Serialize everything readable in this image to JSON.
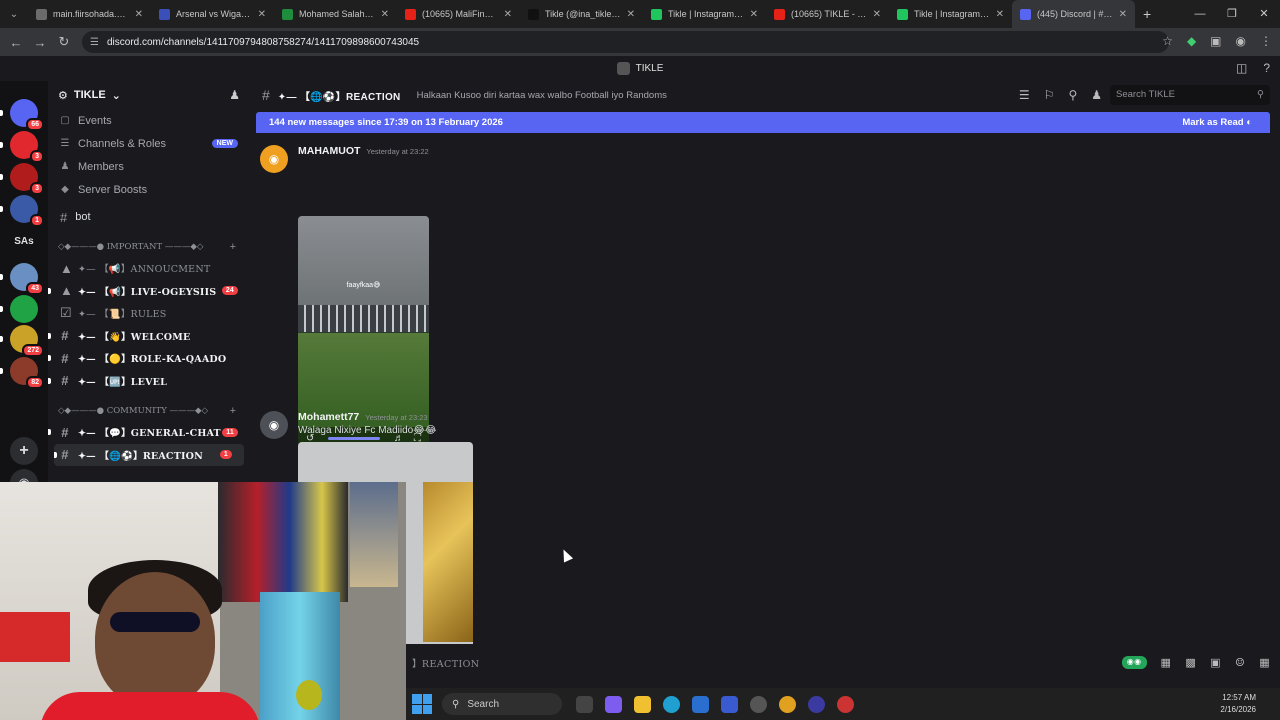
{
  "browser": {
    "tabs": [
      {
        "title": "main.fiirsohada.club",
        "color": "#6b6b6b"
      },
      {
        "title": "Arsenal vs Wigan - En",
        "color": "#3b4fb8"
      },
      {
        "title": "Mohamed Salah - sta",
        "color": "#1e8e3e"
      },
      {
        "title": "(10665) MaliFino - Yo",
        "color": "#e62117"
      },
      {
        "title": "Tikle (@ina_tikle) | Ti",
        "color": "#111111"
      },
      {
        "title": "Tikle | Instagram, Tik",
        "color": "#21c55d"
      },
      {
        "title": "(10665) TIKLE - YouTu",
        "color": "#e62117"
      },
      {
        "title": "Tikle | Instagram, Tik",
        "color": "#21c55d"
      },
      {
        "title": "(445) Discord | #✦—",
        "color": "#5865f2"
      }
    ],
    "url": "discord.com/channels/1411709794808758274/1411709898600743045"
  },
  "discord": {
    "window_title": "TIKLE",
    "server": {
      "name": "TIKLE",
      "nav": [
        {
          "label": "Events",
          "icon": "calendar-icon"
        },
        {
          "label": "Channels & Roles",
          "icon": "list-icon",
          "badge": "NEW"
        },
        {
          "label": "Members",
          "icon": "members-icon"
        },
        {
          "label": "Server Boosts",
          "icon": "boost-icon"
        }
      ],
      "bot_channel": "bot",
      "categories": [
        {
          "label": "◇◆———● IMPORTANT ———◆◇",
          "channels": [
            {
              "label": "✦— 【📢】ANNOUCMENT",
              "icon": "megaphone-icon",
              "unread": false
            },
            {
              "label": "✦— 【📢】LIVE-OGEYSIIS",
              "icon": "megaphone-icon",
              "unread": true,
              "badge": "24"
            },
            {
              "label": "✦— 【📜】RULES",
              "icon": "rules-icon",
              "unread": false
            },
            {
              "label": "✦— 【👋】WELCOME",
              "icon": "hash-icon",
              "unread": true
            },
            {
              "label": "✦— 【🟡】ROLE-KA-QAADO",
              "icon": "hash-icon",
              "unread": true
            },
            {
              "label": "✦— 【🆙】LEVEL",
              "icon": "hash-icon",
              "unread": true
            }
          ]
        },
        {
          "label": "◇◆———● COMMUNITY ———◆◇",
          "channels": [
            {
              "label": "✦— 【💬】GENERAL-CHAT",
              "icon": "hash-icon",
              "unread": true,
              "badge": "11"
            },
            {
              "label": "✦— 【🌐⚽】REACTION",
              "icon": "hash-icon",
              "unread": true,
              "badge": "1",
              "active": true
            }
          ]
        }
      ]
    },
    "guilds": [
      {
        "name": "dm-icon",
        "badge": "66",
        "color": "#5865f2"
      },
      {
        "name": "server-red-icon",
        "badge": "3",
        "color": "#e0282e"
      },
      {
        "name": "server-star-icon",
        "badge": "3",
        "color": "#b01c1c"
      },
      {
        "name": "server-ball-icon",
        "badge": "1",
        "color": "#3a5aa8"
      },
      {
        "name": "SAs",
        "badge": "",
        "color": ""
      },
      {
        "name": "server-photo-icon",
        "badge": "43",
        "color": "#6a8fc2"
      },
      {
        "name": "server-green-icon",
        "badge": "",
        "color": "#1fa345"
      },
      {
        "name": "server-gold-icon",
        "badge": "272",
        "color": "#c9a227"
      },
      {
        "name": "server-thumb-icon",
        "badge": "82",
        "color": "#8c3a2a"
      }
    ],
    "channel": {
      "name": "✦— 【🌐⚽】REACTION",
      "topic": "Halkaan Kusoo diri kartaa wax walbo Football iyo Randoms",
      "search_placeholder": "Search TIKLE"
    },
    "new_messages_bar": {
      "text": "144 new messages since 17:39 on 13 February 2026",
      "action": "Mark as Read"
    },
    "messages": [
      {
        "author": "MAHAMUOT",
        "timestamp": "Yesterday at 23:22",
        "text": "",
        "video_caption": "faayfkaa😅"
      },
      {
        "author": "Mohamett77",
        "timestamp": "Yesterday at 23:23",
        "text": "Walaga Nixiye Fc Madiido😂😂",
        "video_caption": ""
      }
    ],
    "composer_placeholder": "】REACTION"
  },
  "taskbar": {
    "search": "Search",
    "time": "12:57 AM",
    "date": "2/16/2026"
  }
}
